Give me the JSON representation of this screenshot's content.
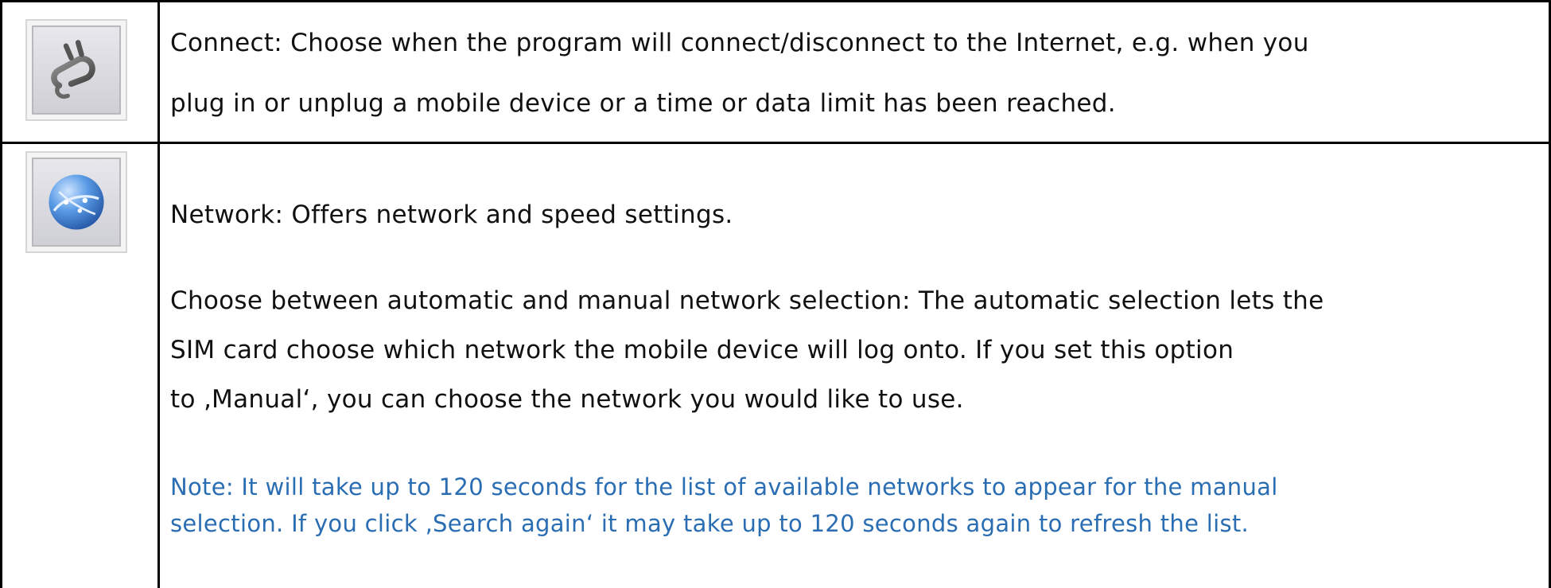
{
  "rows": [
    {
      "icon": "plug-icon",
      "lines": [
        "Connect: Choose when the program will connect/disconnect to the Internet, e.g. when you",
        "plug in or unplug a mobile device or a time or data limit has been reached."
      ]
    },
    {
      "icon": "globe-network-icon",
      "heading": "Network: Offers network and speed settings.",
      "paragraph_lines": [
        "Choose between automatic and manual network selection: The automatic selection lets the",
        "SIM card choose which network the mobile device will log onto. If you set this option",
        "to ‚Manual‘, you can choose the network you would like to use."
      ],
      "note_lines": [
        "Note: It will take up to 120 seconds for the list of available networks to appear for the manual",
        "selection. If you click ‚Search again‘ it may take up to 120 seconds again to refresh the list."
      ]
    }
  ],
  "colors": {
    "note": "#2a6db3",
    "border": "#000000"
  }
}
